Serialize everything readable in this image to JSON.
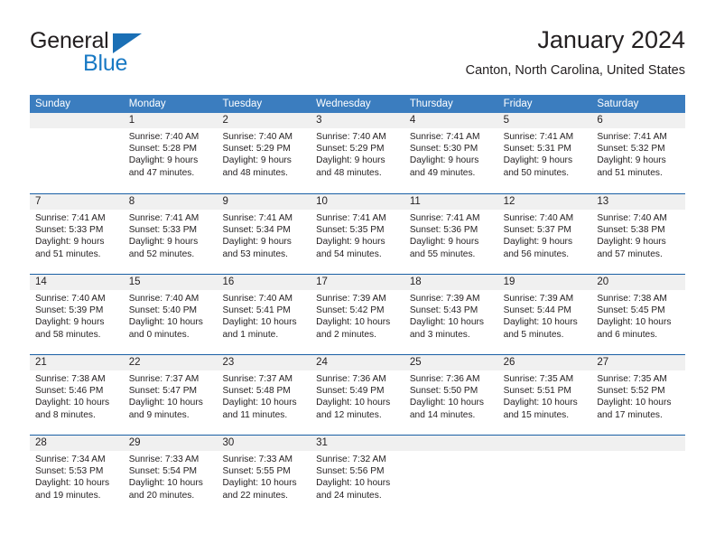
{
  "brand": {
    "name_part1": "General",
    "name_part2": "Blue",
    "colors": {
      "blue": "#1879c4",
      "triangle": "#1a6fb5",
      "dark": "#231f20"
    }
  },
  "header": {
    "title": "January 2024",
    "subtitle": "Canton, North Carolina, United States"
  },
  "calendar": {
    "header_bg": "#3b7dbf",
    "row_divider": "#1a60a5",
    "daynum_bg": "#f0f0f0",
    "weekdays": [
      "Sunday",
      "Monday",
      "Tuesday",
      "Wednesday",
      "Thursday",
      "Friday",
      "Saturday"
    ],
    "weeks": [
      [
        {
          "day": "",
          "sunrise": "",
          "sunset": "",
          "daylight1": "",
          "daylight2": ""
        },
        {
          "day": "1",
          "sunrise": "Sunrise: 7:40 AM",
          "sunset": "Sunset: 5:28 PM",
          "daylight1": "Daylight: 9 hours",
          "daylight2": "and 47 minutes."
        },
        {
          "day": "2",
          "sunrise": "Sunrise: 7:40 AM",
          "sunset": "Sunset: 5:29 PM",
          "daylight1": "Daylight: 9 hours",
          "daylight2": "and 48 minutes."
        },
        {
          "day": "3",
          "sunrise": "Sunrise: 7:40 AM",
          "sunset": "Sunset: 5:29 PM",
          "daylight1": "Daylight: 9 hours",
          "daylight2": "and 48 minutes."
        },
        {
          "day": "4",
          "sunrise": "Sunrise: 7:41 AM",
          "sunset": "Sunset: 5:30 PM",
          "daylight1": "Daylight: 9 hours",
          "daylight2": "and 49 minutes."
        },
        {
          "day": "5",
          "sunrise": "Sunrise: 7:41 AM",
          "sunset": "Sunset: 5:31 PM",
          "daylight1": "Daylight: 9 hours",
          "daylight2": "and 50 minutes."
        },
        {
          "day": "6",
          "sunrise": "Sunrise: 7:41 AM",
          "sunset": "Sunset: 5:32 PM",
          "daylight1": "Daylight: 9 hours",
          "daylight2": "and 51 minutes."
        }
      ],
      [
        {
          "day": "7",
          "sunrise": "Sunrise: 7:41 AM",
          "sunset": "Sunset: 5:33 PM",
          "daylight1": "Daylight: 9 hours",
          "daylight2": "and 51 minutes."
        },
        {
          "day": "8",
          "sunrise": "Sunrise: 7:41 AM",
          "sunset": "Sunset: 5:33 PM",
          "daylight1": "Daylight: 9 hours",
          "daylight2": "and 52 minutes."
        },
        {
          "day": "9",
          "sunrise": "Sunrise: 7:41 AM",
          "sunset": "Sunset: 5:34 PM",
          "daylight1": "Daylight: 9 hours",
          "daylight2": "and 53 minutes."
        },
        {
          "day": "10",
          "sunrise": "Sunrise: 7:41 AM",
          "sunset": "Sunset: 5:35 PM",
          "daylight1": "Daylight: 9 hours",
          "daylight2": "and 54 minutes."
        },
        {
          "day": "11",
          "sunrise": "Sunrise: 7:41 AM",
          "sunset": "Sunset: 5:36 PM",
          "daylight1": "Daylight: 9 hours",
          "daylight2": "and 55 minutes."
        },
        {
          "day": "12",
          "sunrise": "Sunrise: 7:40 AM",
          "sunset": "Sunset: 5:37 PM",
          "daylight1": "Daylight: 9 hours",
          "daylight2": "and 56 minutes."
        },
        {
          "day": "13",
          "sunrise": "Sunrise: 7:40 AM",
          "sunset": "Sunset: 5:38 PM",
          "daylight1": "Daylight: 9 hours",
          "daylight2": "and 57 minutes."
        }
      ],
      [
        {
          "day": "14",
          "sunrise": "Sunrise: 7:40 AM",
          "sunset": "Sunset: 5:39 PM",
          "daylight1": "Daylight: 9 hours",
          "daylight2": "and 58 minutes."
        },
        {
          "day": "15",
          "sunrise": "Sunrise: 7:40 AM",
          "sunset": "Sunset: 5:40 PM",
          "daylight1": "Daylight: 10 hours",
          "daylight2": "and 0 minutes."
        },
        {
          "day": "16",
          "sunrise": "Sunrise: 7:40 AM",
          "sunset": "Sunset: 5:41 PM",
          "daylight1": "Daylight: 10 hours",
          "daylight2": "and 1 minute."
        },
        {
          "day": "17",
          "sunrise": "Sunrise: 7:39 AM",
          "sunset": "Sunset: 5:42 PM",
          "daylight1": "Daylight: 10 hours",
          "daylight2": "and 2 minutes."
        },
        {
          "day": "18",
          "sunrise": "Sunrise: 7:39 AM",
          "sunset": "Sunset: 5:43 PM",
          "daylight1": "Daylight: 10 hours",
          "daylight2": "and 3 minutes."
        },
        {
          "day": "19",
          "sunrise": "Sunrise: 7:39 AM",
          "sunset": "Sunset: 5:44 PM",
          "daylight1": "Daylight: 10 hours",
          "daylight2": "and 5 minutes."
        },
        {
          "day": "20",
          "sunrise": "Sunrise: 7:38 AM",
          "sunset": "Sunset: 5:45 PM",
          "daylight1": "Daylight: 10 hours",
          "daylight2": "and 6 minutes."
        }
      ],
      [
        {
          "day": "21",
          "sunrise": "Sunrise: 7:38 AM",
          "sunset": "Sunset: 5:46 PM",
          "daylight1": "Daylight: 10 hours",
          "daylight2": "and 8 minutes."
        },
        {
          "day": "22",
          "sunrise": "Sunrise: 7:37 AM",
          "sunset": "Sunset: 5:47 PM",
          "daylight1": "Daylight: 10 hours",
          "daylight2": "and 9 minutes."
        },
        {
          "day": "23",
          "sunrise": "Sunrise: 7:37 AM",
          "sunset": "Sunset: 5:48 PM",
          "daylight1": "Daylight: 10 hours",
          "daylight2": "and 11 minutes."
        },
        {
          "day": "24",
          "sunrise": "Sunrise: 7:36 AM",
          "sunset": "Sunset: 5:49 PM",
          "daylight1": "Daylight: 10 hours",
          "daylight2": "and 12 minutes."
        },
        {
          "day": "25",
          "sunrise": "Sunrise: 7:36 AM",
          "sunset": "Sunset: 5:50 PM",
          "daylight1": "Daylight: 10 hours",
          "daylight2": "and 14 minutes."
        },
        {
          "day": "26",
          "sunrise": "Sunrise: 7:35 AM",
          "sunset": "Sunset: 5:51 PM",
          "daylight1": "Daylight: 10 hours",
          "daylight2": "and 15 minutes."
        },
        {
          "day": "27",
          "sunrise": "Sunrise: 7:35 AM",
          "sunset": "Sunset: 5:52 PM",
          "daylight1": "Daylight: 10 hours",
          "daylight2": "and 17 minutes."
        }
      ],
      [
        {
          "day": "28",
          "sunrise": "Sunrise: 7:34 AM",
          "sunset": "Sunset: 5:53 PM",
          "daylight1": "Daylight: 10 hours",
          "daylight2": "and 19 minutes."
        },
        {
          "day": "29",
          "sunrise": "Sunrise: 7:33 AM",
          "sunset": "Sunset: 5:54 PM",
          "daylight1": "Daylight: 10 hours",
          "daylight2": "and 20 minutes."
        },
        {
          "day": "30",
          "sunrise": "Sunrise: 7:33 AM",
          "sunset": "Sunset: 5:55 PM",
          "daylight1": "Daylight: 10 hours",
          "daylight2": "and 22 minutes."
        },
        {
          "day": "31",
          "sunrise": "Sunrise: 7:32 AM",
          "sunset": "Sunset: 5:56 PM",
          "daylight1": "Daylight: 10 hours",
          "daylight2": "and 24 minutes."
        },
        {
          "day": "",
          "sunrise": "",
          "sunset": "",
          "daylight1": "",
          "daylight2": ""
        },
        {
          "day": "",
          "sunrise": "",
          "sunset": "",
          "daylight1": "",
          "daylight2": ""
        },
        {
          "day": "",
          "sunrise": "",
          "sunset": "",
          "daylight1": "",
          "daylight2": ""
        }
      ]
    ]
  }
}
